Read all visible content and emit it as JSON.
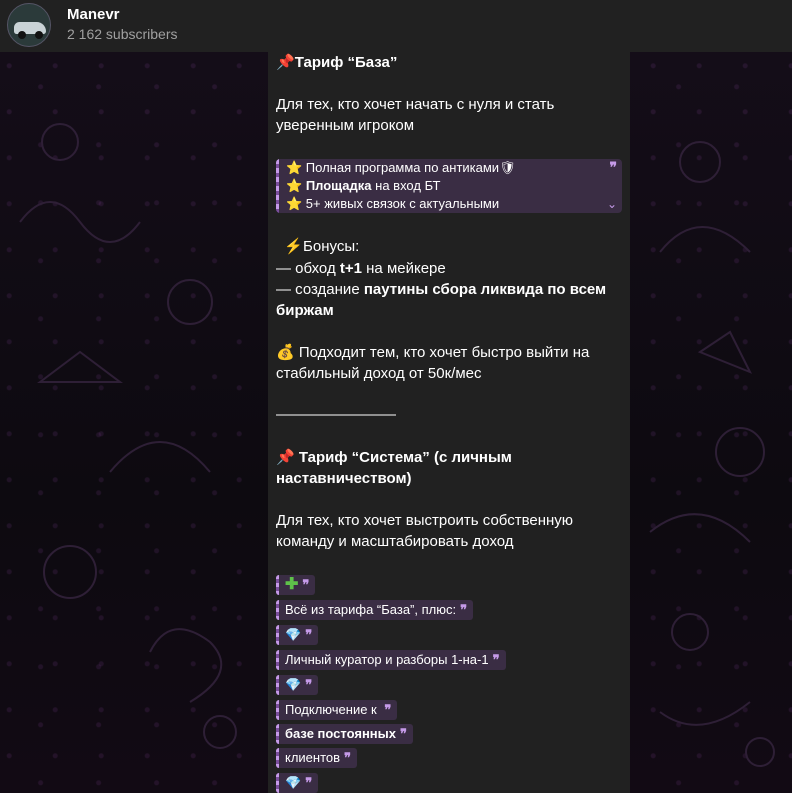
{
  "header": {
    "channel_name": "Manevr",
    "subscribers": "2 162 subscribers"
  },
  "post": {
    "tariff1_title": "Тариф “База”",
    "tariff1_desc_line1": "Для тех, кто хочет начать с нуля и стать",
    "tariff1_desc_line2": "уверенным игроком",
    "quote_lines": [
      {
        "star": "⭐",
        "pre": " Полная программа по антиками",
        "bold": "",
        "post": "",
        "tail": "🛡"
      },
      {
        "star": "⭐",
        "pre": " ",
        "bold": "Площадка",
        "post": " на вход БТ",
        "tail": ""
      },
      {
        "star": "⭐",
        "pre": " 5+ живых связок с актуальными",
        "bold": "",
        "post": "",
        "tail": ""
      }
    ],
    "quote_mark": "❞",
    "expand_chevron": "⌄",
    "bonus_icon": "⚡",
    "bonus_title": "Бонусы:",
    "bonus1_pre": "— обход ",
    "bonus1_bold": "t+1",
    "bonus1_post": " на мейкере",
    "bonus2_pre": "— создание ",
    "bonus2_bold": "паутины сбора ликвида по всем",
    "bonus2_bold_line2": "биржам",
    "money_icon": "💰",
    "fit_line1": " Подходит тем, кто хочет быстро выйти на",
    "fit_line2": "стабильный доход от 50к/мес",
    "divider": "————————",
    "tariff2_icon": "📌",
    "tariff2_title_line1": " Тариф “Система” (с личным",
    "tariff2_title_line2": "наставничеством)",
    "tariff2_desc_line1": "Для тех, кто хочет выстроить собственную",
    "tariff2_desc_line2": "команду и масштабировать доход",
    "pills": [
      {
        "icon": "plus",
        "glyph": "✚",
        "text": ""
      },
      {
        "icon": "",
        "glyph": "",
        "text": "Всё из тарифа “База”, плюс:"
      },
      {
        "icon": "gem",
        "glyph": "💎",
        "text": ""
      },
      {
        "icon": "",
        "glyph": "",
        "text": "Личный куратор и разборы 1-на-1"
      },
      {
        "icon": "gem",
        "glyph": "💎",
        "text": ""
      },
      {
        "icon": "",
        "glyph": "",
        "text": "Подключение к "
      },
      {
        "icon": "",
        "glyph": "",
        "text": "базе постоянных",
        "bold": true
      },
      {
        "icon": "",
        "glyph": "",
        "text": "клиентов"
      },
      {
        "icon": "gem",
        "glyph": "💎",
        "text": ""
      }
    ]
  },
  "colors": {
    "quote_bg": "#3a2d44",
    "quote_accent": "#c59ae8",
    "bubble_bg": "#212121",
    "header_bg": "#212121"
  }
}
